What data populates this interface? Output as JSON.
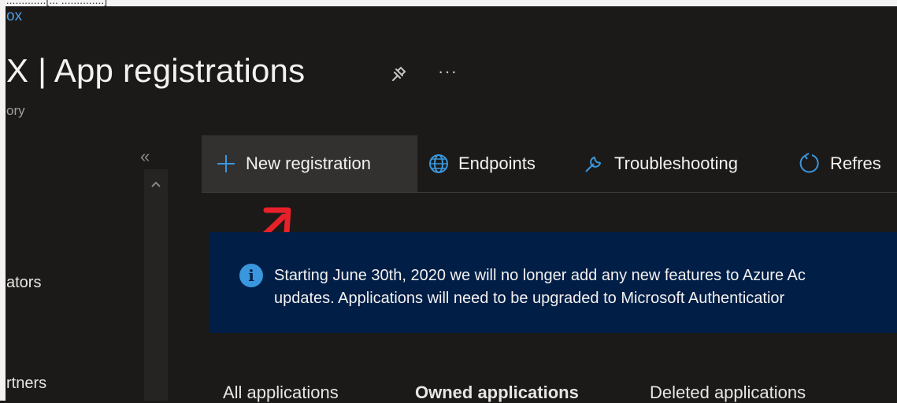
{
  "top_strip": {
    "text": "...............[... ..............]"
  },
  "breadcrumb": "ox",
  "header": {
    "title": "X | App registrations",
    "subtitle": "ory",
    "more_label": "···"
  },
  "sidebar": {
    "collapse_label": "«",
    "items": [
      {
        "label": "ators"
      },
      {
        "label": "rtners"
      }
    ]
  },
  "toolbar": {
    "new_registration": "New registration",
    "endpoints": "Endpoints",
    "troubleshooting": "Troubleshooting",
    "refresh": "Refres"
  },
  "banner": {
    "line1": "Starting June 30th, 2020 we will no longer add any new features to Azure Ac",
    "line2": "updates. Applications will need to be upgraded to Microsoft Authenticatior"
  },
  "tabs": [
    {
      "label": "All applications"
    },
    {
      "label": "Owned applications"
    },
    {
      "label": "Deleted applications"
    }
  ],
  "colors": {
    "background": "#1b1a19",
    "banner": "#001e46",
    "info": "#3a96dd",
    "link": "#4f9be3",
    "annotation_arrow": "#e8202a"
  }
}
